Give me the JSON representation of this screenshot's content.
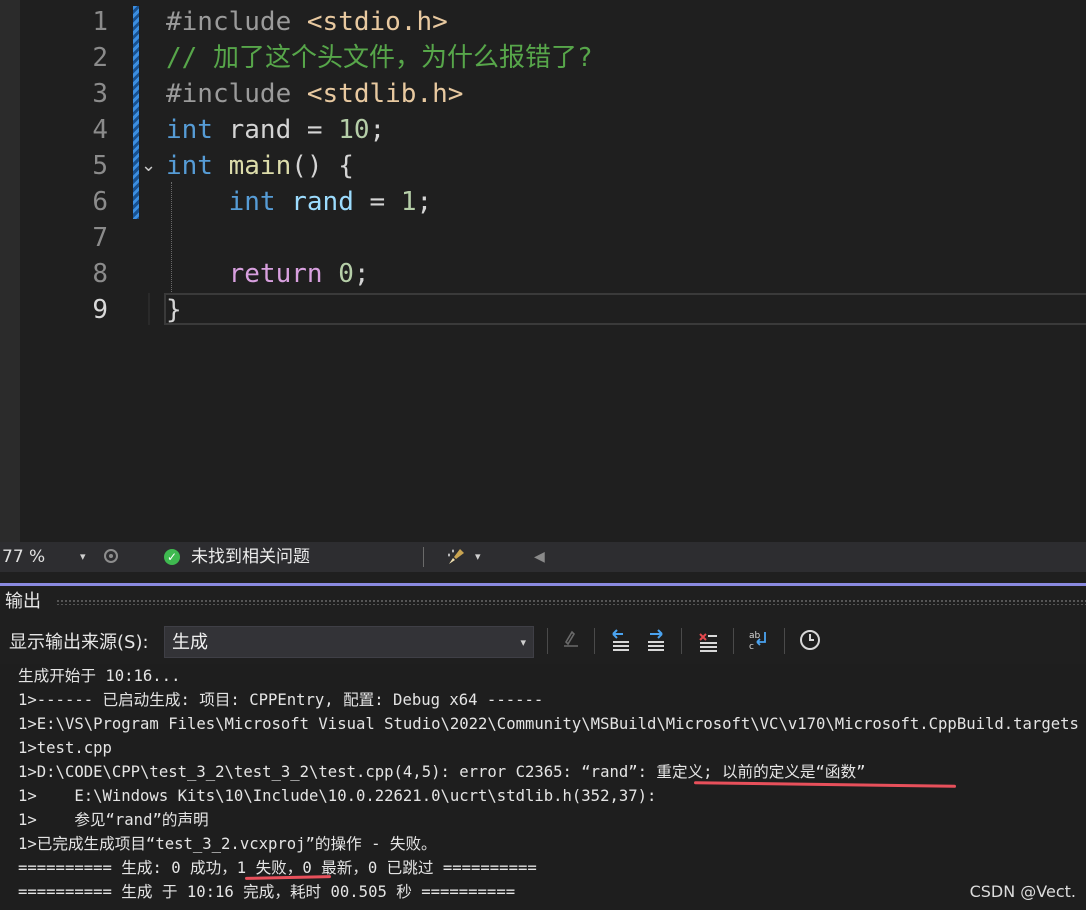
{
  "editor": {
    "lines": [
      {
        "num": "1",
        "tokens": [
          {
            "c": "tok-pre",
            "t": "#include "
          },
          {
            "c": "tok-inc",
            "t": "<stdio.h>"
          }
        ]
      },
      {
        "num": "2",
        "tokens": [
          {
            "c": "tok-com",
            "t": "// 加了这个头文件，为什么报错了?"
          }
        ]
      },
      {
        "num": "3",
        "tokens": [
          {
            "c": "tok-pre",
            "t": "#include "
          },
          {
            "c": "tok-inc",
            "t": "<stdlib.h>"
          }
        ]
      },
      {
        "num": "4",
        "tokens": [
          {
            "c": "tok-kw",
            "t": "int"
          },
          {
            "c": "tok-pl",
            "t": " rand = "
          },
          {
            "c": "tok-num",
            "t": "10"
          },
          {
            "c": "tok-pl",
            "t": ";"
          }
        ]
      },
      {
        "num": "5",
        "tokens": [
          {
            "c": "tok-kw",
            "t": "int"
          },
          {
            "c": "tok-pl",
            "t": " "
          },
          {
            "c": "tok-fn",
            "t": "main"
          },
          {
            "c": "tok-pl",
            "t": "() {"
          }
        ]
      },
      {
        "num": "6",
        "tokens": [
          {
            "c": "tok-pl",
            "t": "    "
          },
          {
            "c": "tok-kw",
            "t": "int"
          },
          {
            "c": "tok-pl",
            "t": " "
          },
          {
            "c": "tok-var",
            "t": "rand"
          },
          {
            "c": "tok-pl",
            "t": " = "
          },
          {
            "c": "tok-num",
            "t": "1"
          },
          {
            "c": "tok-pl",
            "t": ";"
          }
        ]
      },
      {
        "num": "7",
        "tokens": []
      },
      {
        "num": "8",
        "tokens": [
          {
            "c": "tok-pl",
            "t": "    "
          },
          {
            "c": "tok-ret",
            "t": "return"
          },
          {
            "c": "tok-pl",
            "t": " "
          },
          {
            "c": "tok-num",
            "t": "0"
          },
          {
            "c": "tok-pl",
            "t": ";"
          }
        ]
      },
      {
        "num": "9",
        "tokens": [
          {
            "c": "tok-pl",
            "t": "}"
          }
        ]
      }
    ],
    "active_line": "9",
    "fold_glyph": "⌄"
  },
  "status": {
    "zoom": "77 %",
    "zoom_arrow": "▾",
    "issues_icon": "check-circle-icon",
    "issues_text": "未找到相关问题",
    "brush_arrow": "▾",
    "scroll_arrow": "◀"
  },
  "output": {
    "title": "输出",
    "source_label": "显示输出来源(S):",
    "source_value": "生成",
    "source_arrow": "▾",
    "lines": [
      "生成开始于 10:16...",
      "1>------ 已启动生成: 项目: CPPEntry, 配置: Debug x64 ------",
      "1>E:\\VS\\Program Files\\Microsoft Visual Studio\\2022\\Community\\MSBuild\\Microsoft\\VC\\v170\\Microsoft.CppBuild.targets",
      "1>test.cpp",
      "1>D:\\CODE\\CPP\\test_3_2\\test_3_2\\test.cpp(4,5): error C2365: “rand”: 重定义; 以前的定义是“函数”",
      "1>    E:\\Windows Kits\\10\\Include\\10.0.22621.0\\ucrt\\stdlib.h(352,37):",
      "1>    参见“rand”的声明",
      "1>已完成生成项目“test_3_2.vcxproj”的操作 - 失败。",
      "========== 生成: 0 成功，1 失败，0 最新，0 已跳过 ==========",
      "========== 生成 于 10:16 完成，耗时 00.505 秒 =========="
    ]
  },
  "watermark": "CSDN @Vect."
}
